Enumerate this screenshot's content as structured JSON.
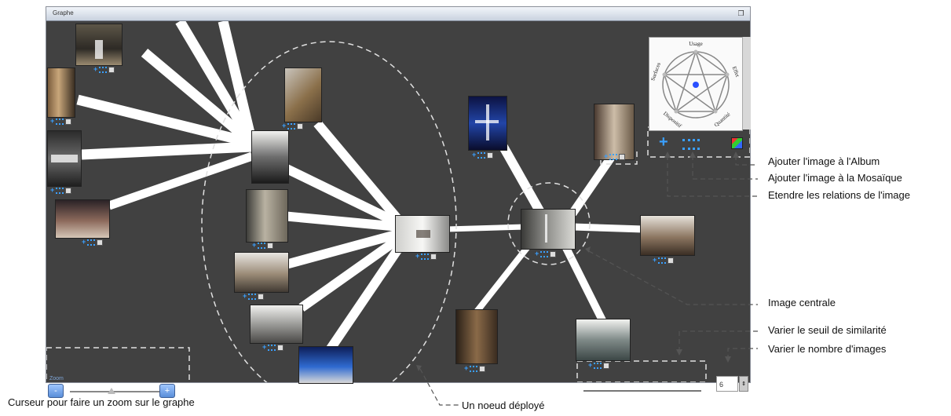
{
  "window": {
    "title": "Graphe"
  },
  "pentagon": {
    "labels": [
      "Usage",
      "Effet",
      "Quantité",
      "Dispositif",
      "Surfaces"
    ]
  },
  "annotations": {
    "add_album": "Ajouter l'image à l'Album",
    "add_mosaic": "Ajouter l'image à la Mosaïque",
    "extend_relations": "Etendre les relations de l'image",
    "central_image": "Image centrale",
    "similarity_threshold": "Varier le seuil de similarité",
    "image_count": "Varier le nombre d'images",
    "zoom_slider": "Curseur pour faire un zoom sur le graphe",
    "expanded_node": "Un noeud déployé"
  },
  "zoom": {
    "label": "Zoom",
    "minus": "-",
    "plus": "+"
  },
  "image_count_value": "6",
  "icons": {
    "add": "plus-icon",
    "mosaic": "mosaic-grid-icon",
    "extend": "extend-relations-icon",
    "restore": "window-restore-icon"
  },
  "colors": {
    "canvas": "#414141",
    "edge": "#ffffff",
    "accent": "#3aa0ff"
  }
}
